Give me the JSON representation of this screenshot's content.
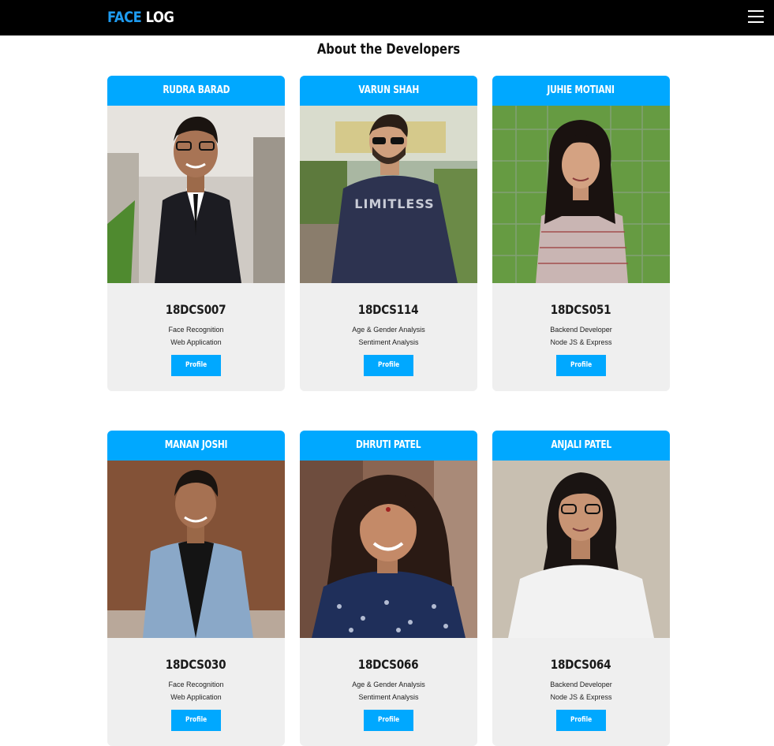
{
  "navbar": {
    "brand_part1": "FACE",
    "brand_part2": "LOG",
    "brand_color": "#1e9bf0",
    "menu_icon": "hamburger-menu-icon"
  },
  "page": {
    "title": "About the Developers"
  },
  "theme": {
    "accent": "#00a8ff",
    "card_bg": "#efefef"
  },
  "developers": [
    {
      "name": "RUDRA BARAD",
      "id": "18DCS007",
      "line1": "Face Recognition",
      "line2": "Web Application",
      "button": "Profile"
    },
    {
      "name": "VARUN SHAH",
      "id": "18DCS114",
      "line1": "Age & Gender Analysis",
      "line2": "Sentiment Analysis",
      "button": "Profile"
    },
    {
      "name": "JUHIE MOTIANI",
      "id": "18DCS051",
      "line1": "Backend Developer",
      "line2": "Node JS & Express",
      "button": "Profile"
    },
    {
      "name": "MANAN JOSHI",
      "id": "18DCS030",
      "line1": "Face Recognition",
      "line2": "Web Application",
      "button": "Profile"
    },
    {
      "name": "DHRUTI PATEL",
      "id": "18DCS066",
      "line1": "Age & Gender Analysis",
      "line2": "Sentiment Analysis",
      "button": "Profile"
    },
    {
      "name": "ANJALI PATEL",
      "id": "18DCS064",
      "line1": "Backend Developer",
      "line2": "Node JS & Express",
      "button": "Profile"
    }
  ]
}
